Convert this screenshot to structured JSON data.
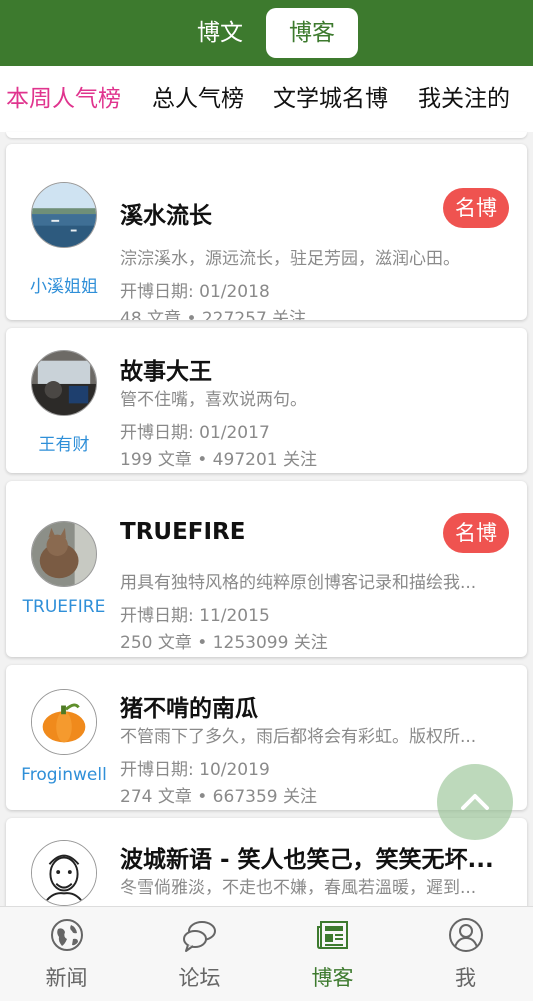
{
  "header": {
    "segments": [
      {
        "label": "博文",
        "active": false
      },
      {
        "label": "博客",
        "active": true
      }
    ]
  },
  "tabs": [
    {
      "label": "本周人气榜",
      "active": true
    },
    {
      "label": "总人气榜",
      "active": false
    },
    {
      "label": "文学城名博",
      "active": false
    },
    {
      "label": "我关注的",
      "active": false
    }
  ],
  "blogs": [
    {
      "author": "小溪姐姐",
      "title": "溪水流长",
      "description": "淙淙溪水，源远流长，驻足芳园，滋润心田。",
      "start_date": "开博日期: 01/2018",
      "stats": "48 文章 • 227257 关注",
      "badge": "名博",
      "avatar_icon": "lake-avatar-icon"
    },
    {
      "author": "王有财",
      "title": "故事大王",
      "description": "管不住嘴，喜欢说两句。",
      "start_date": "开博日期: 01/2017",
      "stats": "199 文章 • 497201 关注",
      "badge": "",
      "avatar_icon": "car-interior-avatar-icon"
    },
    {
      "author": "TRUEFIRE",
      "title": "TRUEFIRE",
      "description": "用具有独特风格的纯粹原创博客记录和描绘我...",
      "start_date": "开博日期: 11/2015",
      "stats": "250 文章 • 1253099 关注",
      "badge": "名博",
      "avatar_icon": "cat-avatar-icon"
    },
    {
      "author": "Froginwell",
      "title": "猪不啃的南瓜",
      "description": "不管雨下了多久，雨后都将会有彩虹。版权所...",
      "start_date": "开博日期: 10/2019",
      "stats": "274 文章 • 667359 关注",
      "badge": "",
      "avatar_icon": "pumpkin-avatar-icon"
    },
    {
      "author": "",
      "title": "波城新语 - 笑人也笑己，笑笑无坏...",
      "description": "冬雪倘雅淡，不走也不嫌，春風若溫暖，遲到...",
      "start_date": "",
      "stats": "",
      "badge": "",
      "avatar_icon": "sketch-portrait-avatar-icon"
    }
  ],
  "bottom_nav": [
    {
      "label": "新闻",
      "icon": "globe-icon",
      "active": false
    },
    {
      "label": "论坛",
      "icon": "chat-bubbles-icon",
      "active": false
    },
    {
      "label": "博客",
      "icon": "newspaper-icon",
      "active": true
    },
    {
      "label": "我",
      "icon": "user-icon",
      "active": false
    }
  ],
  "colors": {
    "header_green": "#3d7a2e",
    "active_tab_pink": "#e0348e",
    "badge_red": "#ef5350",
    "author_blue": "#2f8fd8"
  }
}
